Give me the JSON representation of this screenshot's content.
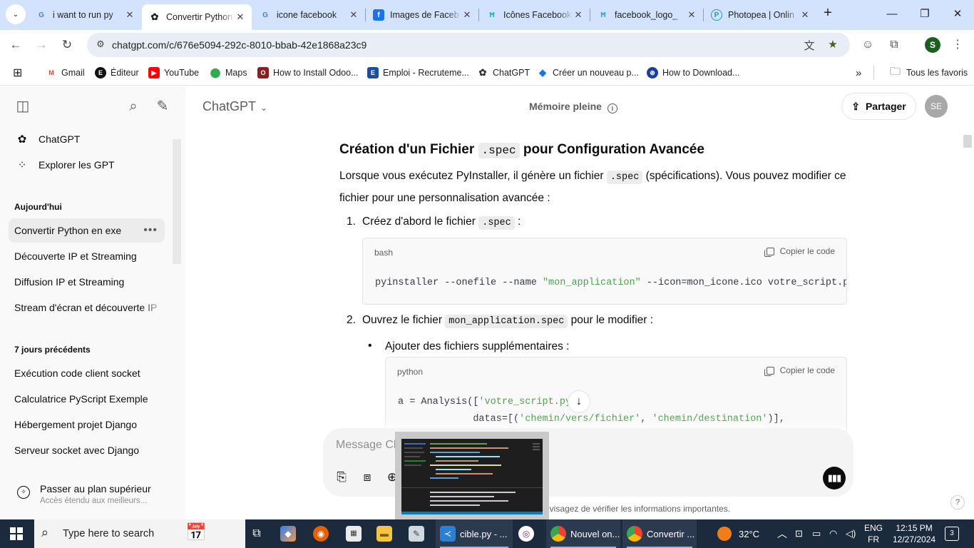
{
  "browser": {
    "tabs": [
      {
        "title": "i want to run py",
        "favicon": "G",
        "active": false
      },
      {
        "title": "Convertir Python",
        "favicon": "openai",
        "active": true
      },
      {
        "title": "icone facebook",
        "favicon": "G",
        "active": false
      },
      {
        "title": "Images de Faceb",
        "favicon": "f",
        "active": false
      },
      {
        "title": "Icônes Facebook",
        "favicon": "H",
        "active": false
      },
      {
        "title": "facebook_logo_",
        "favicon": "H",
        "active": false
      },
      {
        "title": "Photopea | Onlin",
        "favicon": "P",
        "active": false
      }
    ],
    "url": "chatgpt.com/c/676e5094-292c-8010-bbab-42e1868a23c9",
    "profile_initial": "S",
    "bookmarks": [
      {
        "label": "Gmail",
        "color": "#ea4335",
        "icon": "M"
      },
      {
        "label": "Éditeur",
        "color": "#111111",
        "icon": "E"
      },
      {
        "label": "YouTube",
        "color": "#ff0000",
        "icon": "▶"
      },
      {
        "label": "Maps",
        "color": "#34a853",
        "icon": "●"
      },
      {
        "label": "How to Install Odoo...",
        "color": "#8b1e1e",
        "icon": "O"
      },
      {
        "label": "Emploi - Recruteme...",
        "color": "#1a4fa0",
        "icon": "E"
      },
      {
        "label": "ChatGPT",
        "color": "#555555",
        "icon": "✿"
      },
      {
        "label": "Créer un nouveau p...",
        "color": "#1a73e8",
        "icon": "◆"
      },
      {
        "label": "How to Download...",
        "color": "#1a3fa0",
        "icon": "⊕"
      }
    ],
    "all_bookmarks": "Tous les favoris"
  },
  "sidebar": {
    "top": [
      {
        "label": "ChatGPT",
        "icon": "openai-icon"
      },
      {
        "label": "Explorer les GPT",
        "icon": "grid-icon"
      }
    ],
    "today_heading": "Aujourd'hui",
    "today": [
      "Convertir Python en exe",
      "Découverte IP et Streaming",
      "Diffusion IP et Streaming",
      "Stream d'écran et découverte IP"
    ],
    "week_heading": "7 jours précédents",
    "week": [
      "Exécution code client socket",
      "Calculatrice PyScript Exemple",
      "Hébergement projet Django",
      "Serveur socket avec Django"
    ],
    "upgrade_title": "Passer au plan supérieur",
    "upgrade_sub": "Accès étendu aux meilleurs..."
  },
  "header": {
    "model": "ChatGPT",
    "memory": "Mémoire pleine",
    "share": "Partager",
    "avatar": "SE"
  },
  "content": {
    "heading_pre": "Création d'un Fichier",
    "heading_code": ".spec",
    "heading_post": "pour Configuration Avancée",
    "para_1": "Lorsque vous exécutez PyInstaller, il génère un fichier",
    "para_code": ".spec",
    "para_2": "(spécifications). Vous pouvez modifier ce fichier pour une personnalisation avancée :",
    "step1_num": "1.",
    "step1_text": "Créez d'abord le fichier",
    "step1_code": ".spec",
    "step1_after": ":",
    "code1_lang": "bash",
    "copy_label": "Copier le code",
    "code1_a": "pyinstaller --onefile --name ",
    "code1_str": "\"mon_application\"",
    "code1_b": " --icon=mon_icone.ico votre_script.py",
    "step2_num": "2.",
    "step2_text": "Ouvrez le fichier",
    "step2_code": "mon_application.spec",
    "step2_after": "pour le modifier :",
    "bullet1": "Ajouter des fichiers supplémentaires :",
    "code2_lang": "python",
    "code2_l1_a": "a = Analysis([",
    "code2_l1_str": "'votre_script.py'",
    "code2_l1_b": "],",
    "code2_l2_a": "             datas=[(",
    "code2_l2_s1": "'chemin/vers/fichier'",
    "code2_l2_sep": ", ",
    "code2_l2_s2": "'chemin/destination'",
    "code2_l2_b": ")],"
  },
  "composer": {
    "placeholder": "Message ChatGPT",
    "disclaimer": "nvisagez de vérifier les informations importantes."
  },
  "taskbar": {
    "search_placeholder": "Type here to search",
    "apps": [
      {
        "label": "cible.py - ...",
        "color": "#2b7fd4",
        "icon": "≺"
      },
      {
        "label": "Nouvel on...",
        "color": "#dd4b39",
        "icon": "G"
      },
      {
        "label": "Convertir ...",
        "color": "#dd4b39",
        "icon": "G"
      }
    ],
    "weather": "32°C",
    "lang_1": "ENG",
    "lang_2": "FR",
    "time": "12:15 PM",
    "date": "12/27/2024",
    "notifications": "3"
  }
}
